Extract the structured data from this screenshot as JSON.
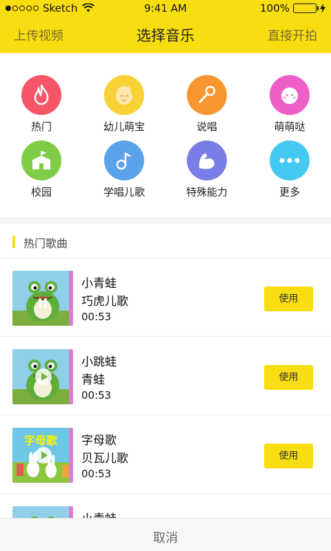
{
  "status_bar": {
    "carrier": "Sketch",
    "time": "9:41 AM",
    "battery": "100%",
    "battery_level": 1.0,
    "signal_bars_filled": 1,
    "signal_bars_total": 5
  },
  "nav": {
    "left": "上传视频",
    "title": "选择音乐",
    "right": "直接开拍"
  },
  "categories": [
    {
      "label": "热门",
      "icon": "flame-icon",
      "color": "#f6566a"
    },
    {
      "label": "幼儿萌宝",
      "icon": "baby-face-icon",
      "color": "#f8d234"
    },
    {
      "label": "说唱",
      "icon": "microphone-icon",
      "color": "#f7962f"
    },
    {
      "label": "萌萌哒",
      "icon": "cute-face-icon",
      "color": "#ee5fc7"
    },
    {
      "label": "校园",
      "icon": "school-icon",
      "color": "#7fcd46"
    },
    {
      "label": "学唱儿歌",
      "icon": "music-note-icon",
      "color": "#5aa3ea"
    },
    {
      "label": "特殊能力",
      "icon": "muscle-arm-icon",
      "color": "#7a7de7"
    },
    {
      "label": "更多",
      "icon": "more-dots-icon",
      "color": "#44c9f0"
    }
  ],
  "section": {
    "title": "热门歌曲"
  },
  "songs": [
    {
      "title": "小青蛙",
      "artist": "巧虎儿歌",
      "duration": "00:53",
      "action": "使用",
      "thumb": "frog-thumbnail",
      "state": "paused"
    },
    {
      "title": "小跳蛙",
      "artist": "青蛙",
      "duration": "00:53",
      "action": "使用",
      "thumb": "frog-thumbnail",
      "state": "play"
    },
    {
      "title": "字母歌",
      "artist": "贝瓦儿歌",
      "duration": "00:53",
      "action": "使用",
      "thumb": "alphabet-song-thumbnail",
      "thumb_text": "字母歌",
      "state": "play"
    },
    {
      "title": "小青蛙",
      "thumb": "frog-thumbnail"
    }
  ],
  "cancel": "取消"
}
